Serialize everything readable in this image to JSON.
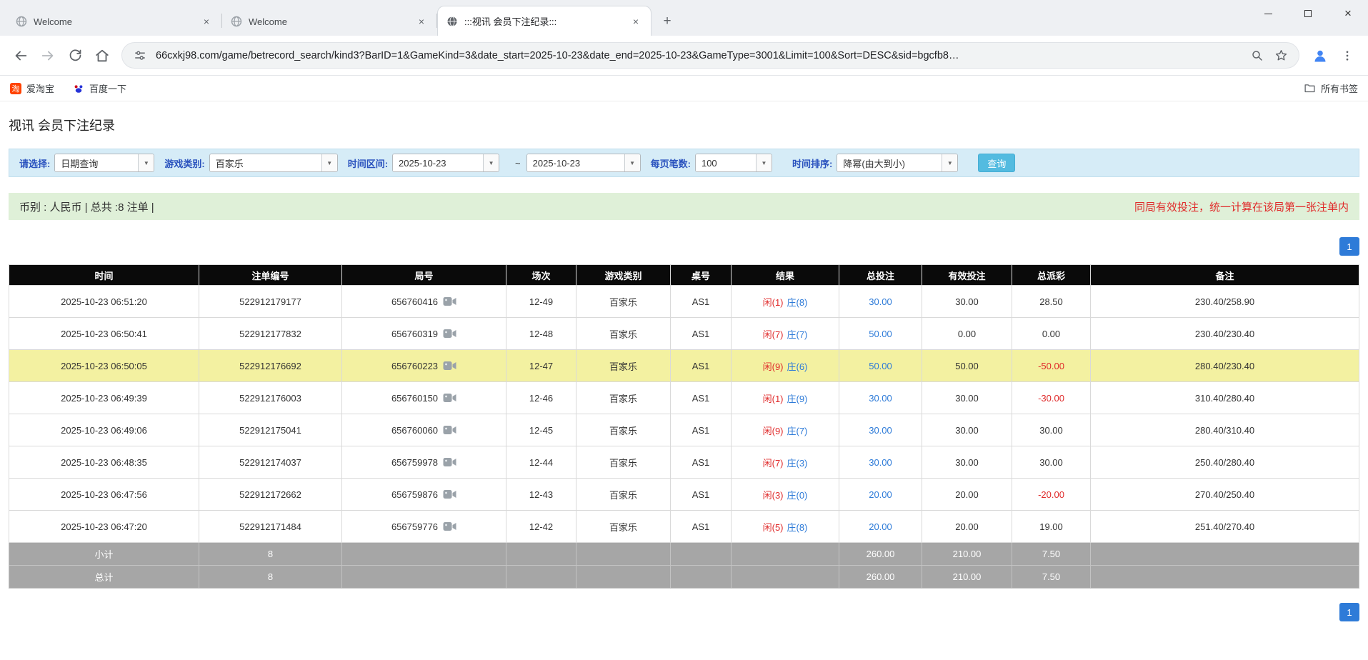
{
  "colors": {
    "accent_blue": "#2e7bd8",
    "negative_red": "#e02b2b",
    "result_player_red": "#e02b2b",
    "result_banker_blue": "#2e7bd8",
    "highlight_yellow": "#f3f1a1",
    "filter_bar_bg": "#d6ecf7",
    "filter_label_blue": "#2a52be",
    "info_bar_bg": "#dff0d8",
    "search_button_bg": "#53bbe0",
    "table_header_bg": "#0a0a0a",
    "table_footer_bg": "#a6a6a6"
  },
  "icons": {
    "dropdown": "▼",
    "close_glyph": "×",
    "new_tab_glyph": "+"
  },
  "browser": {
    "tabs": [
      {
        "title": "Welcome"
      },
      {
        "title": "Welcome"
      },
      {
        "title": ":::视讯 会员下注纪录:::"
      }
    ],
    "url": "66cxkj98.com/game/betrecord_search/kind3?BarID=1&GameKind=3&date_start=2025-10-23&date_end=2025-10-23&GameType=3001&Limit=100&Sort=DESC&sid=bgcfb8…",
    "bookmarks": [
      {
        "label": "爱淘宝",
        "badge": "淘"
      },
      {
        "label": "百度一下"
      }
    ],
    "all_bookmarks_label": "所有书签"
  },
  "page": {
    "title": "视讯 会员下注纪录",
    "filter": {
      "select_label": "请选择:",
      "select_value": "日期查询",
      "game_type_label": "游戏类别:",
      "game_type_value": "百家乐",
      "date_range_label": "时间区间:",
      "date_start": "2025-10-23",
      "date_separator": "~",
      "date_end": "2025-10-23",
      "page_size_label": "每页笔数:",
      "page_size_value": "100",
      "sort_label": "时间排序:",
      "sort_value": "降幂(由大到小)",
      "search_button": "查询"
    },
    "info_bar": {
      "left": "币别 : 人民币 | 总共 :8 注单 |",
      "right": "同局有效投注，统一计算在该局第一张注单内"
    },
    "pagination": {
      "page": "1"
    },
    "table": {
      "headers": [
        "时间",
        "注单编号",
        "局号",
        "场次",
        "游戏类别",
        "桌号",
        "结果",
        "总投注",
        "有效投注",
        "总派彩",
        "备注"
      ],
      "rows": [
        {
          "time": "2025-10-23 06:51:20",
          "bet_id": "522912179177",
          "round": "656760416",
          "session": "12-49",
          "game": "百家乐",
          "table": "AS1",
          "result_player": "闲(1)",
          "result_banker": "庄(8)",
          "total_bet": "30.00",
          "valid_bet": "30.00",
          "payout": "28.50",
          "remark": "230.40/258.90",
          "highlight": false
        },
        {
          "time": "2025-10-23 06:50:41",
          "bet_id": "522912177832",
          "round": "656760319",
          "session": "12-48",
          "game": "百家乐",
          "table": "AS1",
          "result_player": "闲(7)",
          "result_banker": "庄(7)",
          "total_bet": "50.00",
          "valid_bet": "0.00",
          "payout": "0.00",
          "remark": "230.40/230.40",
          "highlight": false
        },
        {
          "time": "2025-10-23 06:50:05",
          "bet_id": "522912176692",
          "round": "656760223",
          "session": "12-47",
          "game": "百家乐",
          "table": "AS1",
          "result_player": "闲(9)",
          "result_banker": "庄(6)",
          "total_bet": "50.00",
          "valid_bet": "50.00",
          "payout": "-50.00",
          "remark": "280.40/230.40",
          "highlight": true
        },
        {
          "time": "2025-10-23 06:49:39",
          "bet_id": "522912176003",
          "round": "656760150",
          "session": "12-46",
          "game": "百家乐",
          "table": "AS1",
          "result_player": "闲(1)",
          "result_banker": "庄(9)",
          "total_bet": "30.00",
          "valid_bet": "30.00",
          "payout": "-30.00",
          "remark": "310.40/280.40",
          "highlight": false
        },
        {
          "time": "2025-10-23 06:49:06",
          "bet_id": "522912175041",
          "round": "656760060",
          "session": "12-45",
          "game": "百家乐",
          "table": "AS1",
          "result_player": "闲(9)",
          "result_banker": "庄(7)",
          "total_bet": "30.00",
          "valid_bet": "30.00",
          "payout": "30.00",
          "remark": "280.40/310.40",
          "highlight": false
        },
        {
          "time": "2025-10-23 06:48:35",
          "bet_id": "522912174037",
          "round": "656759978",
          "session": "12-44",
          "game": "百家乐",
          "table": "AS1",
          "result_player": "闲(7)",
          "result_banker": "庄(3)",
          "total_bet": "30.00",
          "valid_bet": "30.00",
          "payout": "30.00",
          "remark": "250.40/280.40",
          "highlight": false
        },
        {
          "time": "2025-10-23 06:47:56",
          "bet_id": "522912172662",
          "round": "656759876",
          "session": "12-43",
          "game": "百家乐",
          "table": "AS1",
          "result_player": "闲(3)",
          "result_banker": "庄(0)",
          "total_bet": "20.00",
          "valid_bet": "20.00",
          "payout": "-20.00",
          "remark": "270.40/250.40",
          "highlight": false
        },
        {
          "time": "2025-10-23 06:47:20",
          "bet_id": "522912171484",
          "round": "656759776",
          "session": "12-42",
          "game": "百家乐",
          "table": "AS1",
          "result_player": "闲(5)",
          "result_banker": "庄(8)",
          "total_bet": "20.00",
          "valid_bet": "20.00",
          "payout": "19.00",
          "remark": "251.40/270.40",
          "highlight": false
        }
      ],
      "footer": [
        {
          "label": "小计",
          "count": "8",
          "total_bet": "260.00",
          "valid_bet": "210.00",
          "payout": "7.50"
        },
        {
          "label": "总计",
          "count": "8",
          "total_bet": "260.00",
          "valid_bet": "210.00",
          "payout": "7.50"
        }
      ]
    }
  }
}
